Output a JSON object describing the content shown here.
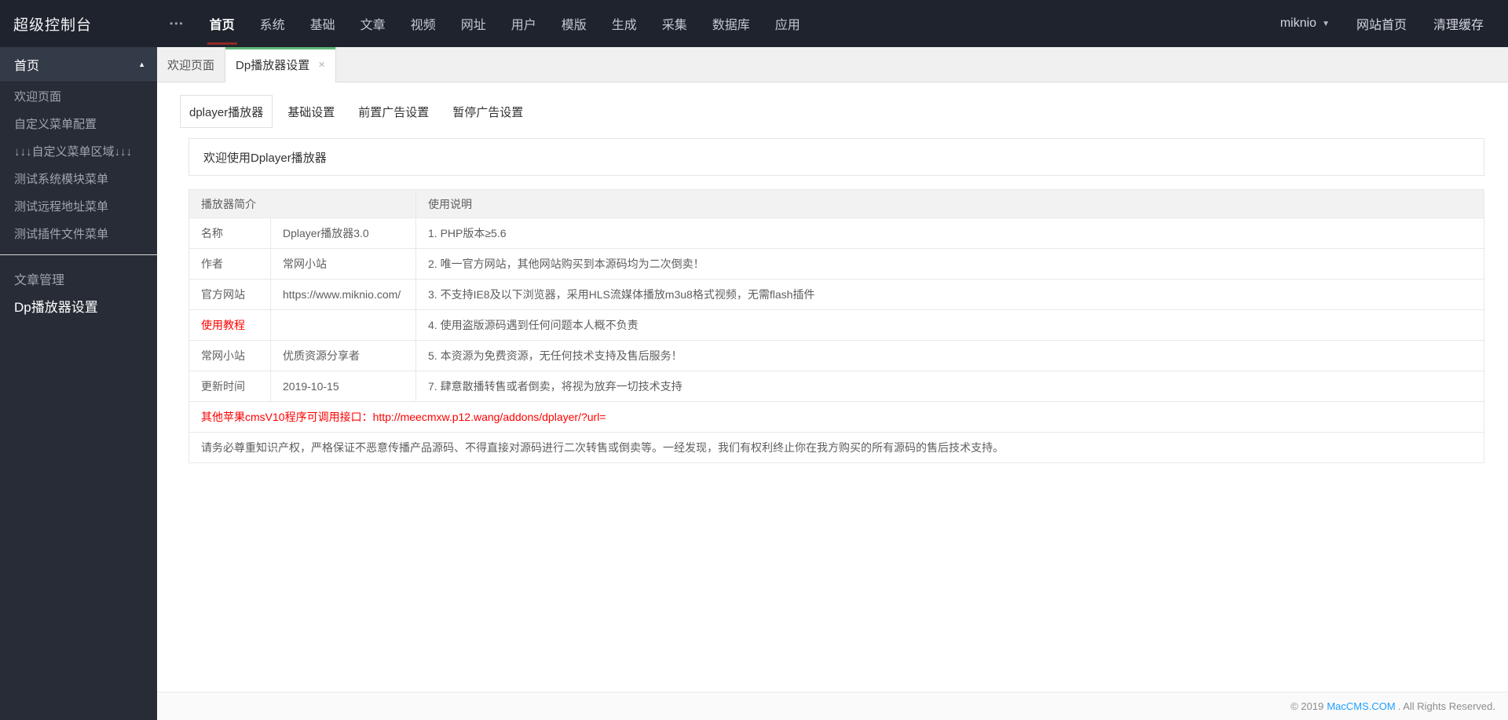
{
  "icons": {
    "more": "•••",
    "caret_down": "▼",
    "chevron_up": "▲",
    "close": "×"
  },
  "colors": {
    "topbar_bg": "#1e232d",
    "sidebar_bg": "#272c37",
    "accent_green": "#5FB878",
    "nav_active_underline": "#8f2b25",
    "link_blue": "#1E9FFF",
    "alert_red": "#ff0000"
  },
  "topbar": {
    "brand": "超级控制台",
    "nav": [
      {
        "label": "首页",
        "active": true
      },
      {
        "label": "系统"
      },
      {
        "label": "基础"
      },
      {
        "label": "文章"
      },
      {
        "label": "视频"
      },
      {
        "label": "网址"
      },
      {
        "label": "用户"
      },
      {
        "label": "模版"
      },
      {
        "label": "生成"
      },
      {
        "label": "采集"
      },
      {
        "label": "数据库"
      },
      {
        "label": "应用"
      }
    ],
    "user": "miknio",
    "right_actions": [
      "网站首页",
      "清理缓存"
    ]
  },
  "sidebar": {
    "sections": [
      {
        "header": "首页",
        "highlight": true,
        "items": [
          {
            "label": "欢迎页面"
          },
          {
            "label": "自定义菜单配置"
          },
          {
            "label": "↓↓↓自定义菜单区域↓↓↓"
          },
          {
            "label": "测试系统模块菜单"
          },
          {
            "label": "测试远程地址菜单"
          },
          {
            "label": "测试插件文件菜单"
          }
        ]
      },
      {
        "header": "文章管理",
        "highlight": false,
        "items": [
          {
            "label": "Dp播放器设置",
            "active": true
          }
        ]
      }
    ]
  },
  "workspace_tabs": [
    {
      "label": "欢迎页面"
    },
    {
      "label": "Dp播放器设置",
      "active": true,
      "closable": true
    }
  ],
  "content_tabs": [
    {
      "label": "dplayer播放器",
      "active": true
    },
    {
      "label": "基础设置"
    },
    {
      "label": "前置广告设置"
    },
    {
      "label": "暂停广告设置"
    }
  ],
  "welcome_text": "欢迎使用Dplayer播放器",
  "info_table": {
    "headers": [
      "播放器简介",
      "使用说明"
    ],
    "rows": [
      {
        "label": "名称",
        "value": "Dplayer播放器3.0",
        "note": "1. PHP版本≥5.6"
      },
      {
        "label": "作者",
        "value": "常网小站",
        "note": "2. 唯一官方网站，其他网站购买到本源码均为二次倒卖！"
      },
      {
        "label": "官方网站",
        "value": "https://www.miknio.com/",
        "note": "3. 不支持IE8及以下浏览器，采用HLS流媒体播放m3u8格式视频，无需flash插件"
      },
      {
        "label": "使用教程",
        "value": "",
        "note": "4. 使用盗版源码遇到任何问题本人概不负责",
        "label_red": true,
        "label_link": true
      },
      {
        "label": "常网小站",
        "value": "优质资源分享者",
        "note": "5. 本资源为免费资源，无任何技术支持及售后服务！"
      },
      {
        "label": "更新时间",
        "value": "2019-10-15",
        "note": "7. 肆意散播转售或者倒卖，将视为放弃一切技术支持"
      }
    ],
    "api_row": "其他苹果cmsV10程序可调用接口：http://meecmxw.p12.wang/addons/dplayer/?url=",
    "notice_row": "请务必尊重知识产权，严格保证不恶意传播产品源码、不得直接对源码进行二次转售或倒卖等。一经发现，我们有权利终止你在我方购买的所有源码的售后技术支持。"
  },
  "footer": {
    "prefix": "© 2019",
    "link": "MacCMS.COM",
    "suffix": ". All Rights Reserved."
  }
}
